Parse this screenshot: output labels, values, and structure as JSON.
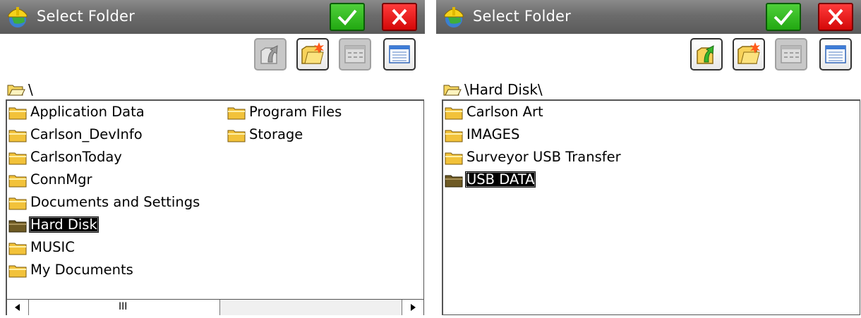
{
  "colors": {
    "titlebar": "#6c6c6c",
    "ok": "#22a812",
    "close": "#d40808",
    "folder": "#f2c23a",
    "selection": "#000000"
  },
  "icons": {
    "app": "hard-hat-globe-icon",
    "ok": "checkmark-icon",
    "close": "close-x-icon",
    "up": "folder-up-arrow-icon",
    "new_folder": "new-folder-icon",
    "list": "list-view-icon",
    "detail": "detail-view-icon",
    "folder": "folder-icon"
  },
  "left": {
    "title": "Select Folder",
    "path": "\\",
    "items": [
      {
        "label": "Application Data"
      },
      {
        "label": "Carlson_DevInfo"
      },
      {
        "label": "CarlsonToday"
      },
      {
        "label": "ConnMgr"
      },
      {
        "label": "Documents and Settings"
      },
      {
        "label": "Hard Disk",
        "selected": true
      },
      {
        "label": "MUSIC"
      },
      {
        "label": "My Documents"
      },
      {
        "label": "Program Files"
      },
      {
        "label": "Storage"
      }
    ],
    "scrollbar": {
      "thumb_grip": "III",
      "left_arrow": "◀",
      "right_arrow": "▶"
    }
  },
  "right": {
    "title": "Select Folder",
    "path": "\\Hard Disk\\",
    "items": [
      {
        "label": "Carlson Art"
      },
      {
        "label": "IMAGES"
      },
      {
        "label": "Surveyor USB Transfer"
      },
      {
        "label": "USB DATA",
        "selected": true
      }
    ]
  }
}
